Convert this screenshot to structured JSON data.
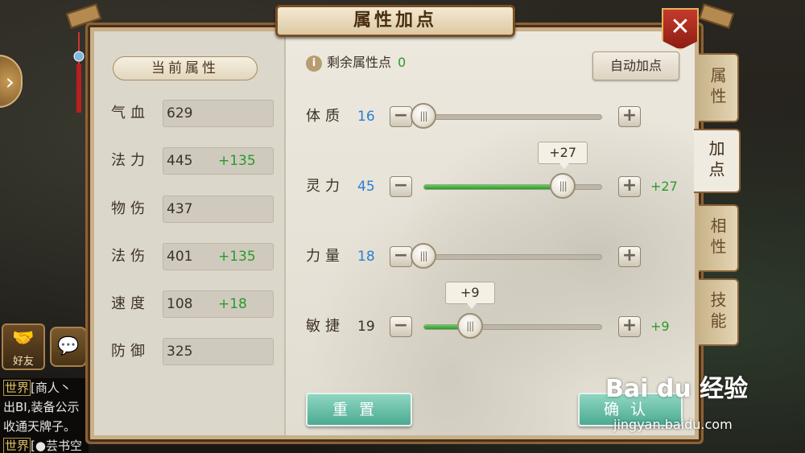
{
  "window": {
    "title": "属性加点",
    "close_label": "✕"
  },
  "left_overlay": {
    "toggle_label": "›",
    "friend_label": "好友",
    "chat_lines": [
      {
        "tag": "世界",
        "text": "[商人丶"
      },
      {
        "tag": "",
        "text": "出BI,装备公示"
      },
      {
        "tag": "",
        "text": "收通天牌子。"
      },
      {
        "tag": "世界",
        "text": "[●芸书空"
      }
    ]
  },
  "current_attributes": {
    "header": "当前属性",
    "rows": [
      {
        "label": "气血",
        "value": "629",
        "bonus": ""
      },
      {
        "label": "法力",
        "value": "445",
        "bonus": "+135"
      },
      {
        "label": "物伤",
        "value": "437",
        "bonus": ""
      },
      {
        "label": "法伤",
        "value": "401",
        "bonus": "+135"
      },
      {
        "label": "速度",
        "value": "108",
        "bonus": "+18"
      },
      {
        "label": "防御",
        "value": "325",
        "bonus": ""
      }
    ]
  },
  "allocation": {
    "remaining_label": "剩余属性点",
    "remaining_value": "0",
    "auto_button": "自动加点",
    "thumb_glyph": "|||",
    "rows": [
      {
        "label": "体质",
        "value": "16",
        "value_color": "#2a7ed6",
        "added": "",
        "fill": 0.0,
        "tip": ""
      },
      {
        "label": "灵力",
        "value": "45",
        "value_color": "#2a7ed6",
        "added": "+27",
        "fill": 0.78,
        "tip": "+27"
      },
      {
        "label": "力量",
        "value": "18",
        "value_color": "#2a7ed6",
        "added": "",
        "fill": 0.0,
        "tip": ""
      },
      {
        "label": "敏捷",
        "value": "19",
        "value_color": "#3a3024",
        "added": "+9",
        "fill": 0.26,
        "tip": "+9"
      }
    ],
    "reset_button": "重置",
    "confirm_button": "确认"
  },
  "tabs": [
    {
      "label": "属性",
      "active": false
    },
    {
      "label": "加点",
      "active": true
    },
    {
      "label": "相性",
      "active": false
    },
    {
      "label": "技能",
      "active": false
    }
  ],
  "watermark": {
    "brand": "Bai du 经验",
    "url": "jingyan.baidu.com"
  },
  "colors": {
    "green": "#2a9a2a",
    "blue": "#2a7ed6",
    "button_teal": "#4caa91",
    "close_red": "#c53a2c"
  }
}
